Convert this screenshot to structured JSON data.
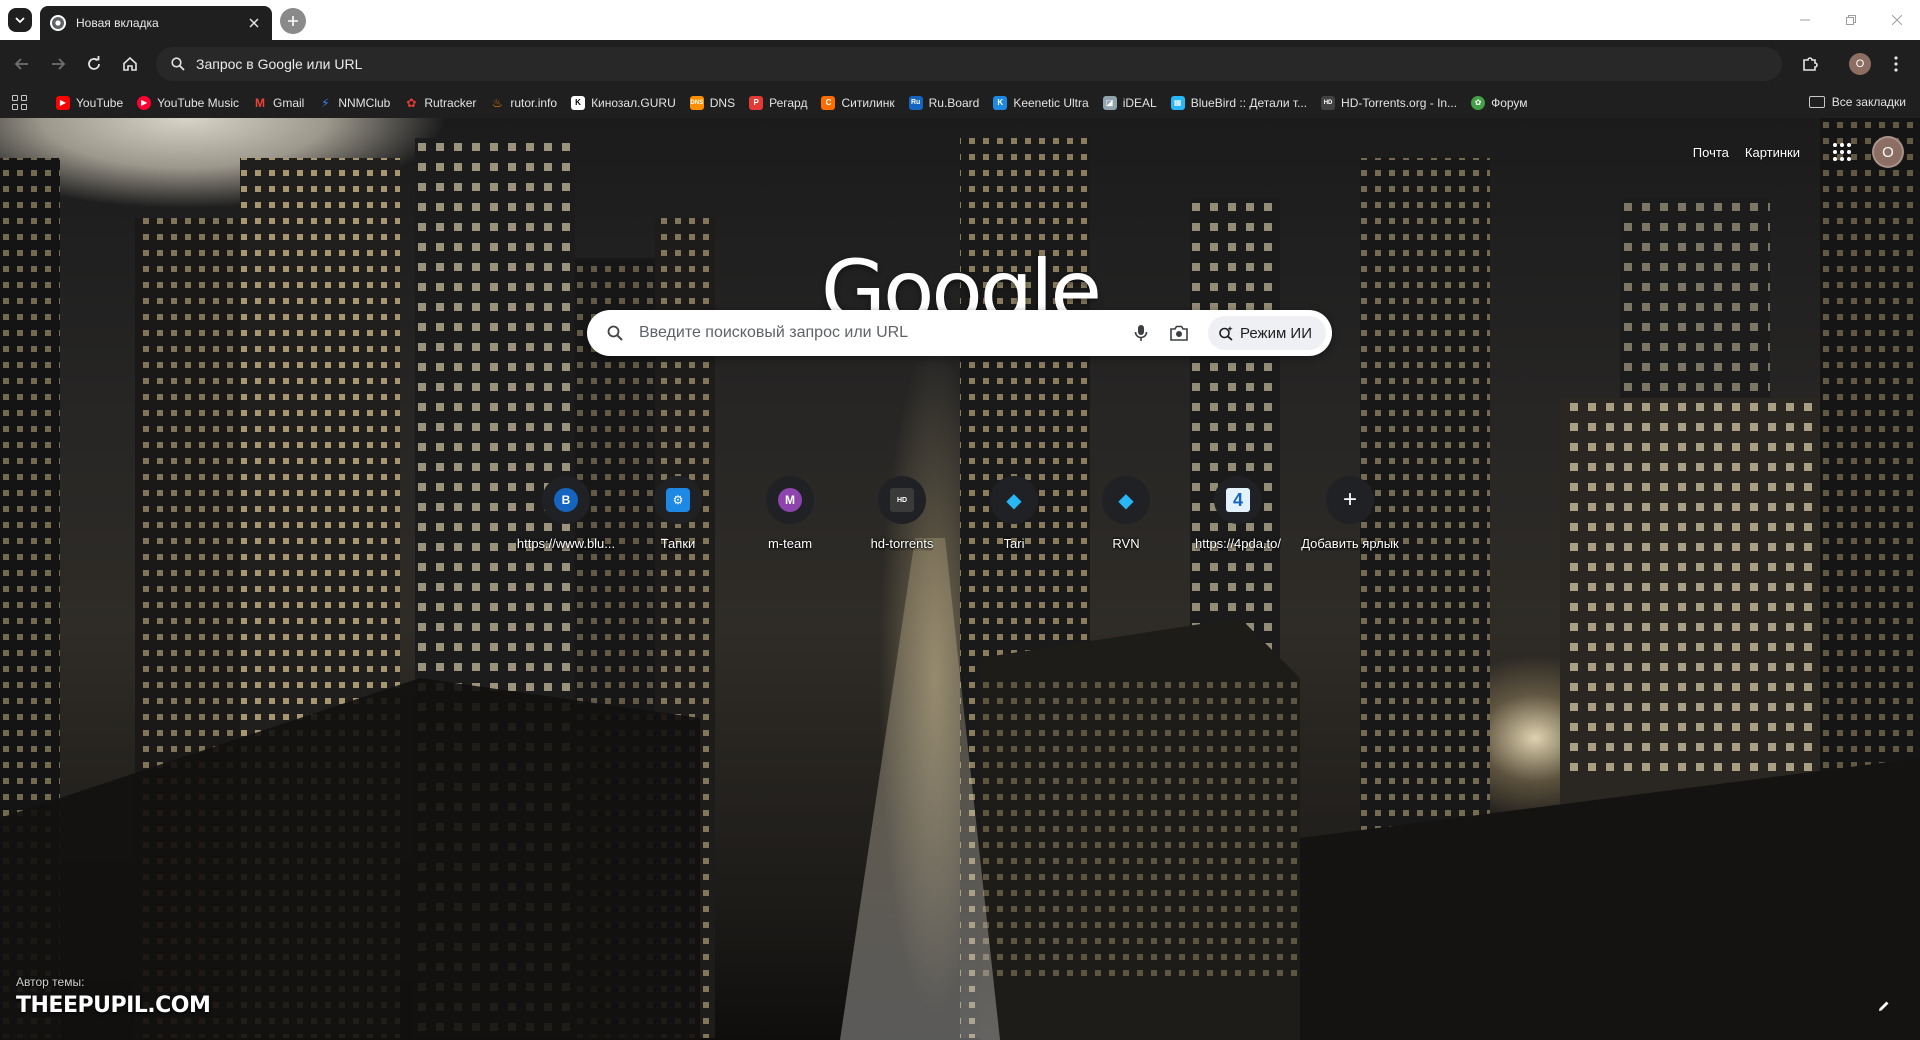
{
  "tab": {
    "title": "Новая вкладка"
  },
  "omnibox": {
    "text": "Запрос в Google или URL"
  },
  "toolbar": {
    "avatar_letter": "O"
  },
  "bookmarks": [
    {
      "label": "YouTube",
      "icon": "youtube-icon",
      "color": "#ff0000"
    },
    {
      "label": "YouTube Music",
      "icon": "youtube-music-icon",
      "color": "#ff0033"
    },
    {
      "label": "Gmail",
      "icon": "gmail-icon",
      "color": "#ea4335"
    },
    {
      "label": "NNMClub",
      "icon": "nnmclub-icon",
      "color": "#3b82f6"
    },
    {
      "label": "Rutracker",
      "icon": "rutracker-icon",
      "color": "#e53935"
    },
    {
      "label": "rutor.info",
      "icon": "rutor-icon",
      "color": "#f57c00"
    },
    {
      "label": "Кинозал.GURU",
      "icon": "kinozal-icon",
      "color": "#ffffff"
    },
    {
      "label": "DNS",
      "icon": "dns-icon",
      "color": "#ff8f00"
    },
    {
      "label": "Регард",
      "icon": "regard-icon",
      "color": "#e53935"
    },
    {
      "label": "Ситилинк",
      "icon": "citilink-icon",
      "color": "#ff6d00"
    },
    {
      "label": "Ru.Board",
      "icon": "ruboard-icon",
      "color": "#1565c0"
    },
    {
      "label": "Keenetic Ultra",
      "icon": "keenetic-icon",
      "color": "#1e88e5"
    },
    {
      "label": "iDEAL",
      "icon": "ideal-icon",
      "color": "#90a4ae"
    },
    {
      "label": "BlueBird :: Детали т...",
      "icon": "bluebird-icon",
      "color": "#29b6f6"
    },
    {
      "label": "HD-Torrents.org - In...",
      "icon": "hd-torrents-icon",
      "color": "#424242"
    },
    {
      "label": "Форум",
      "icon": "forum-icon",
      "color": "#43a047"
    }
  ],
  "bookmarks_all": {
    "label": "Все закладки"
  },
  "ntp": {
    "top_links": {
      "mail": "Почта",
      "images": "Картинки"
    },
    "avatar_letter": "O",
    "logo": "Google",
    "search_placeholder": "Введите поисковый запрос или URL",
    "ai_mode_label": "Режим ИИ",
    "shortcuts": [
      {
        "label": "https://www.blu...",
        "icon_text": "B",
        "icon_color": "#1565c0"
      },
      {
        "label": "Тапки",
        "icon_text": "⚙",
        "icon_color": "#1e88e5"
      },
      {
        "label": "m-team",
        "icon_text": "M",
        "icon_color": "#8e44ad"
      },
      {
        "label": "hd-torrents",
        "icon_text": "HD",
        "icon_color": "#3a3a3a"
      },
      {
        "label": "Tari",
        "icon_text": "◆",
        "icon_color": "#29b6f6"
      },
      {
        "label": "RVN",
        "icon_text": "◆",
        "icon_color": "#29b6f6"
      },
      {
        "label": "https://4pda.to/",
        "icon_text": "4",
        "icon_color": "#2196f3"
      },
      {
        "label": "Добавить ярлык",
        "icon_text": "+",
        "icon_color": "#202124"
      }
    ],
    "attribution": {
      "label": "Автор темы:",
      "name": "THEEPUPIL.COM"
    }
  }
}
